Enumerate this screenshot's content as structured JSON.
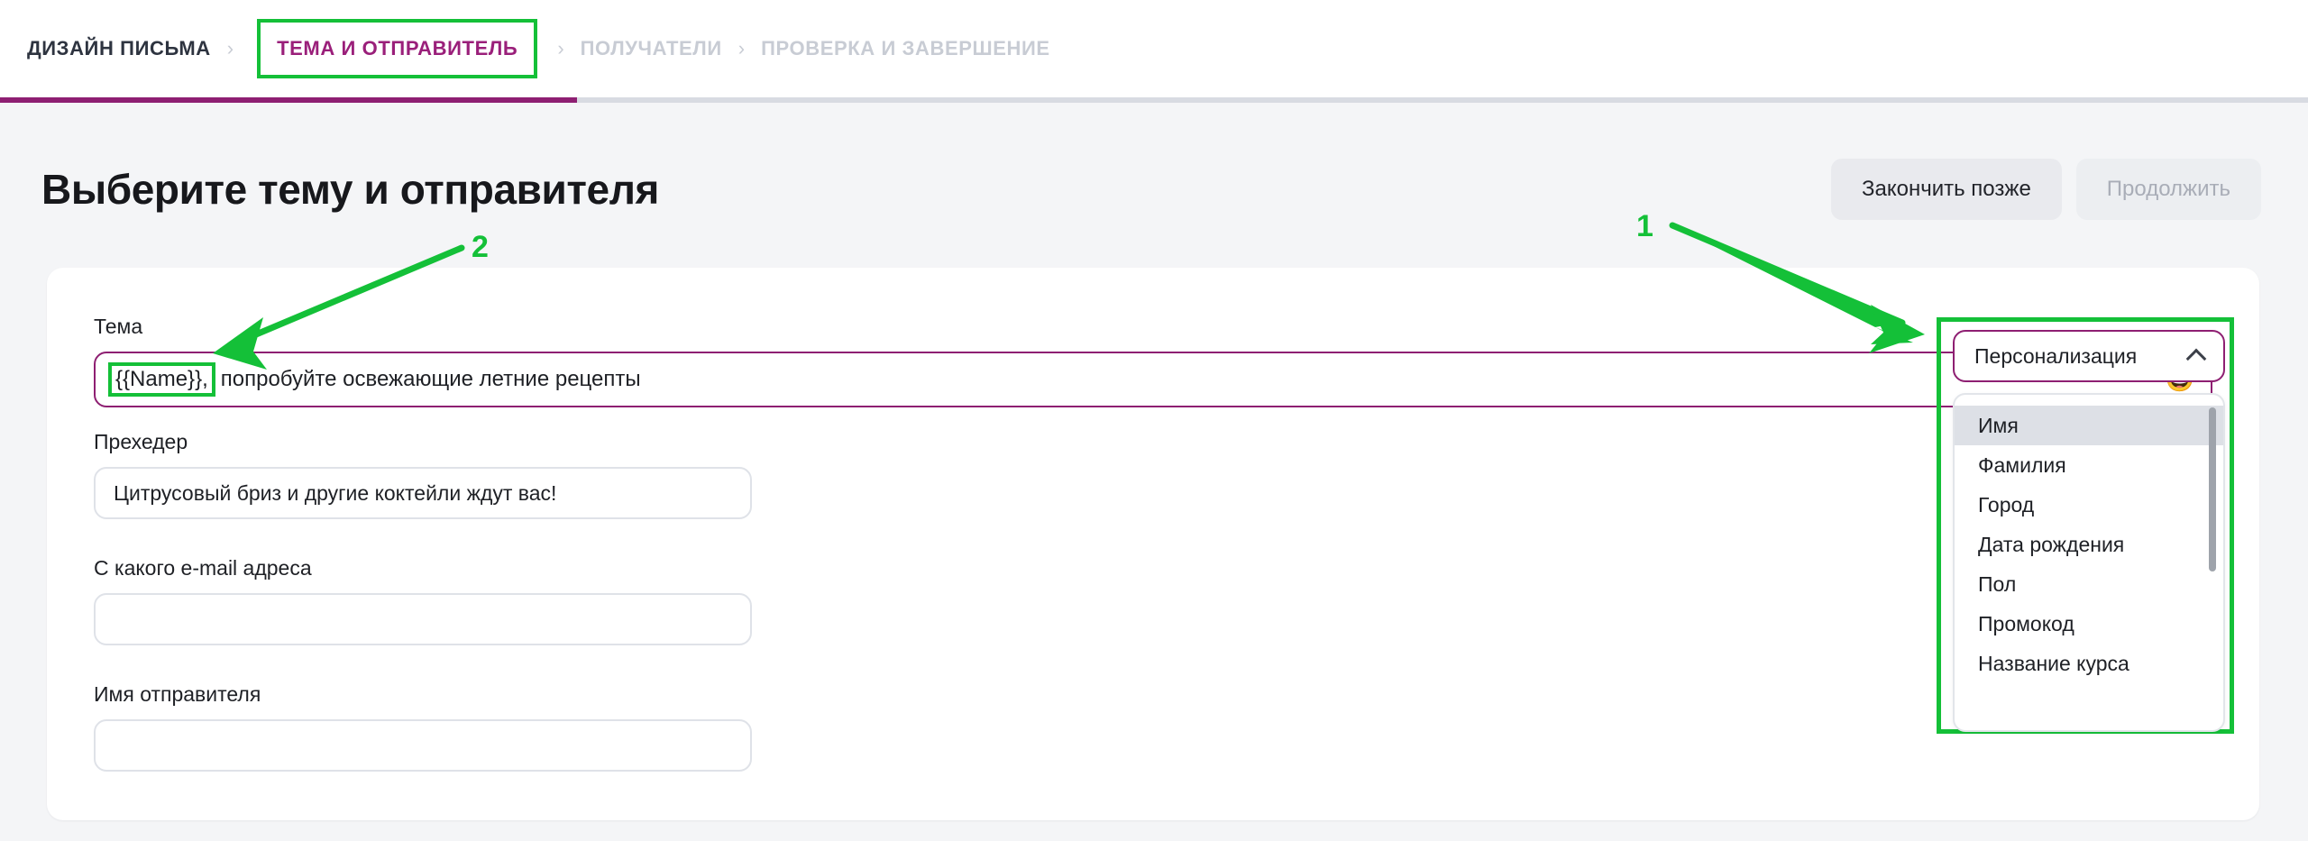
{
  "breadcrumb": {
    "items": [
      {
        "label": "ДИЗАЙН ПИСЬМА",
        "state": "done"
      },
      {
        "label": "ТЕМА И ОТПРАВИТЕЛЬ",
        "state": "current"
      },
      {
        "label": "ПОЛУЧАТЕЛИ",
        "state": "upcoming"
      },
      {
        "label": "ПРОВЕРКА И ЗАВЕРШЕНИЕ",
        "state": "upcoming"
      }
    ],
    "separator": "›"
  },
  "progress": {
    "percent": 25,
    "fill_color": "#8e1f72",
    "track_color": "#d8dbe2"
  },
  "header": {
    "title": "Выберите тему и отправителя",
    "finish_later_label": "Закончить позже",
    "continue_label": "Продолжить"
  },
  "form": {
    "subject": {
      "label": "Тема",
      "token": "{{Name}},",
      "rest": " попробуйте освежающие летние рецепты",
      "emoji": "😃",
      "emoji_icon_name": "emoji-smiley-icon"
    },
    "preheader": {
      "label": "Прехедер",
      "value": "Цитрусовый бриз и другие коктейли ждут вас!",
      "placeholder": ""
    },
    "from_email": {
      "label": "С какого e-mail адреса",
      "value": "",
      "placeholder": ""
    },
    "sender_name": {
      "label": "Имя отправителя",
      "value": "",
      "placeholder": ""
    }
  },
  "personalization": {
    "button_label": "Персонализация",
    "chevron_icon": "chevron-up-icon",
    "expanded": true,
    "items": [
      {
        "label": "Имя",
        "selected": true
      },
      {
        "label": "Фамилия",
        "selected": false
      },
      {
        "label": "Город",
        "selected": false
      },
      {
        "label": "Дата рождения",
        "selected": false
      },
      {
        "label": "Пол",
        "selected": false
      },
      {
        "label": "Промокод",
        "selected": false
      },
      {
        "label": "Название курса",
        "selected": false
      }
    ]
  },
  "annotations": {
    "marker_color": "#14c038",
    "items": [
      {
        "number": "1",
        "target": "personalization-dropdown"
      },
      {
        "number": "2",
        "target": "subject-personalization-token"
      }
    ]
  },
  "colors": {
    "accent_purple": "#8e1f72",
    "annotation_green": "#14c038",
    "page_background": "#f4f5f7",
    "card_background": "#ffffff"
  }
}
